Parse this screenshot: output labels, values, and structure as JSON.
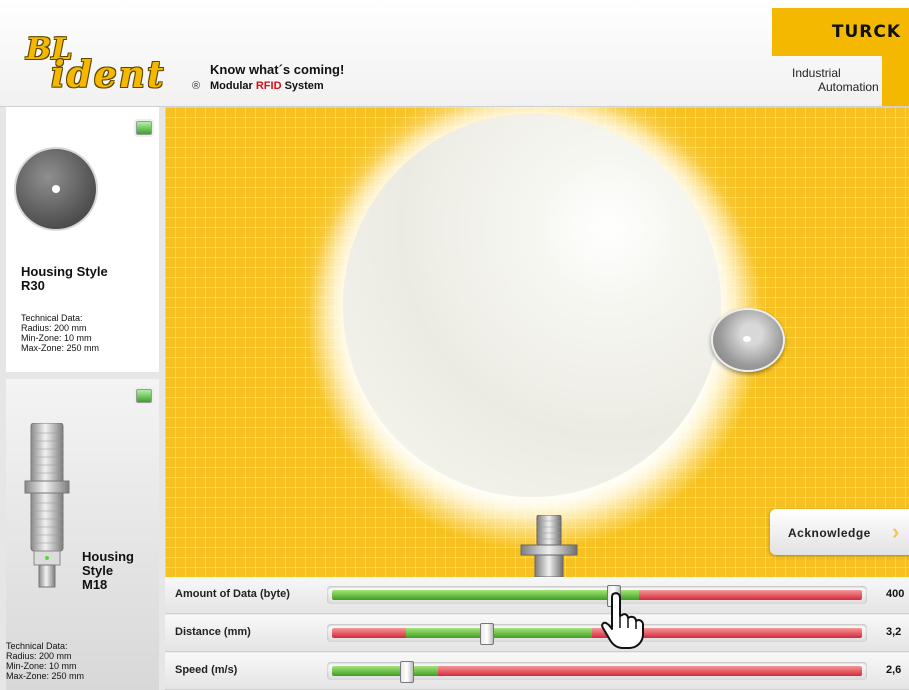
{
  "header": {
    "logo_line1": "BL",
    "logo_line2": "ident",
    "registered": "®",
    "tagline": "Know what´s coming!",
    "subtitle_pre": "Modular ",
    "subtitle_rfid": "RFID",
    "subtitle_post": " System",
    "brand": "TURCK",
    "industrial_line1": "Industrial",
    "industrial_line2": "Automation"
  },
  "sidebar": {
    "panels": [
      {
        "title_line1": "Housing Style",
        "title_line2": "R30",
        "tech": [
          "Technical Data:",
          "Radius: 200 mm",
          "Min-Zone: 10 mm",
          "Max-Zone: 250 mm"
        ],
        "icon": "disc-tag"
      },
      {
        "title_line1": "Housing",
        "title_line2": "Style",
        "title_line3": "M18",
        "tech": [
          "Technical Data:",
          "Radius: 200 mm",
          "Min-Zone: 10 mm",
          "Max-Zone: 250 mm"
        ],
        "icon": "cylindrical-sensor"
      }
    ]
  },
  "main": {
    "acknowledge_label": "Acknowledge",
    "acknowledge_arrow": "›"
  },
  "controls": [
    {
      "label": "Amount of Data (byte)",
      "value_text": "400",
      "thumb_fraction": 0.53,
      "segments": [
        {
          "color": "green",
          "from": 0.0,
          "to": 0.58
        },
        {
          "color": "red",
          "from": 0.58,
          "to": 1.0
        }
      ]
    },
    {
      "label": "Distance (mm)",
      "value_text": "3,2",
      "thumb_fraction": 0.29,
      "segments": [
        {
          "color": "red",
          "from": 0.0,
          "to": 0.14
        },
        {
          "color": "green",
          "from": 0.14,
          "to": 0.49
        },
        {
          "color": "red",
          "from": 0.49,
          "to": 1.0
        }
      ]
    },
    {
      "label": "Speed (m/s)",
      "value_text": "2,6",
      "thumb_fraction": 0.14,
      "segments": [
        {
          "color": "green",
          "from": 0.0,
          "to": 0.2
        },
        {
          "color": "red",
          "from": 0.2,
          "to": 1.0
        }
      ]
    }
  ],
  "colors": {
    "brand_yellow": "#f5b800",
    "background_yellow": "#f7c221",
    "rfid_red": "#d8101a",
    "slider_green": "#4caf2a",
    "slider_red": "#d4283b"
  }
}
